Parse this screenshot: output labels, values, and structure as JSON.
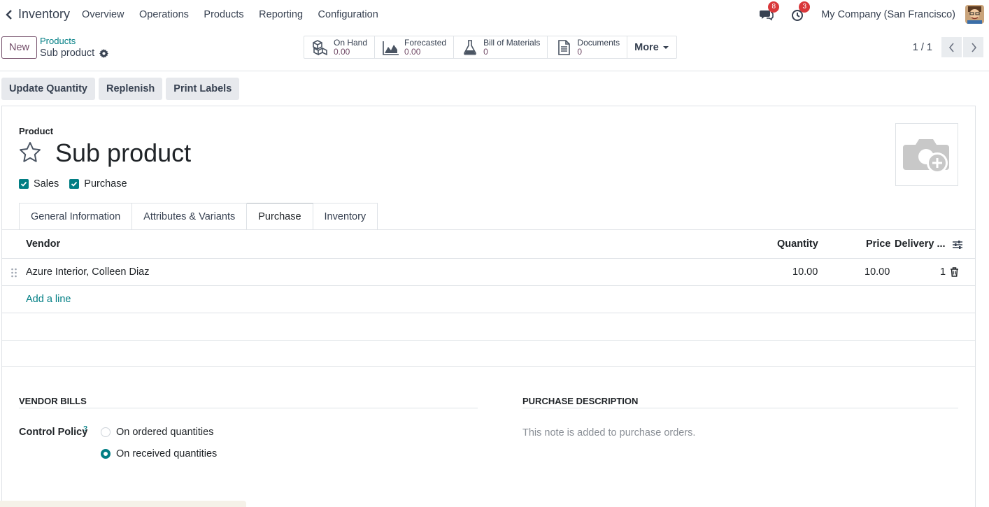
{
  "nav": {
    "app_name": "Inventory",
    "menu": [
      "Overview",
      "Operations",
      "Products",
      "Reporting",
      "Configuration"
    ],
    "messages_count": "8",
    "activities_count": "3",
    "company": "My Company (San Francisco)"
  },
  "control": {
    "new_label": "New",
    "breadcrumb_parent": "Products",
    "breadcrumb_current": "Sub product",
    "smart_buttons": [
      {
        "label": "On Hand",
        "value": "0.00",
        "icon": "boxes-icon"
      },
      {
        "label": "Forecasted",
        "value": "0.00",
        "icon": "area-chart-icon"
      },
      {
        "label": "Bill of Materials",
        "value": "0",
        "icon": "flask-icon"
      },
      {
        "label": "Documents",
        "value": "0",
        "icon": "document-icon"
      }
    ],
    "more_label": "More",
    "pager": "1 / 1"
  },
  "actions": [
    "Update Quantity",
    "Replenish",
    "Print Labels"
  ],
  "form": {
    "type_label": "Product",
    "name": "Sub product",
    "checkbox_sales": "Sales",
    "checkbox_purchase": "Purchase",
    "tabs": [
      "General Information",
      "Attributes & Variants",
      "Purchase",
      "Inventory"
    ],
    "active_tab": "Purchase",
    "table": {
      "headers": {
        "vendor": "Vendor",
        "quantity": "Quantity",
        "price": "Price",
        "delivery": "Delivery ..."
      },
      "rows": [
        {
          "vendor": "Azure Interior, Colleen Diaz",
          "quantity": "10.00",
          "price": "10.00",
          "delivery": "1"
        }
      ],
      "add_line": "Add a line"
    },
    "vendor_bills": {
      "title": "VENDOR BILLS",
      "control_policy_label": "Control Policy",
      "help_mark": "?",
      "options": [
        "On ordered quantities",
        "On received quantities"
      ],
      "selected": "On received quantities"
    },
    "purchase_description": {
      "title": "PURCHASE DESCRIPTION",
      "placeholder": "This note is added to purchase orders."
    }
  },
  "colors": {
    "accent": "#714b67",
    "link": "#017e84",
    "badge": "#d9383b"
  }
}
